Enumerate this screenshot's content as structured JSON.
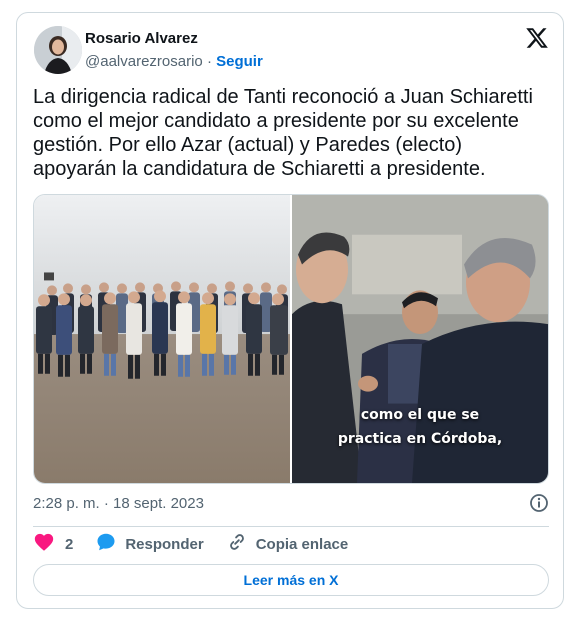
{
  "author": {
    "name": "Rosario Alvarez",
    "handle": "@aalvarezrosario",
    "separator": "·",
    "follow_label": "Seguir"
  },
  "tweet": {
    "text": "La dirigencia radical de Tanti reconoció a Juan Schiaretti como el mejor candidato a presidente por su excelente gestión. Por ello Azar (actual) y Paredes (electo) apoyarán la candidatura de Schiaretti a presidente."
  },
  "media": {
    "video_caption_line1": "como el que se",
    "video_caption_line2": "practica en Córdoba,"
  },
  "meta": {
    "timestamp": "2:28 p. m. · 18 sept. 2023"
  },
  "actions": {
    "like_count": "2",
    "reply_label": "Responder",
    "copy_link_label": "Copia enlace"
  },
  "read_more_label": "Leer más en X",
  "colors": {
    "link_blue": "#006fd6",
    "like_red": "#f91880",
    "reply_blue": "#1d9bf0",
    "muted_gray": "#536471",
    "border": "#cfd9de"
  },
  "icons": [
    "x-logo-icon",
    "info-icon",
    "heart-icon",
    "reply-bubble-icon",
    "link-icon"
  ]
}
